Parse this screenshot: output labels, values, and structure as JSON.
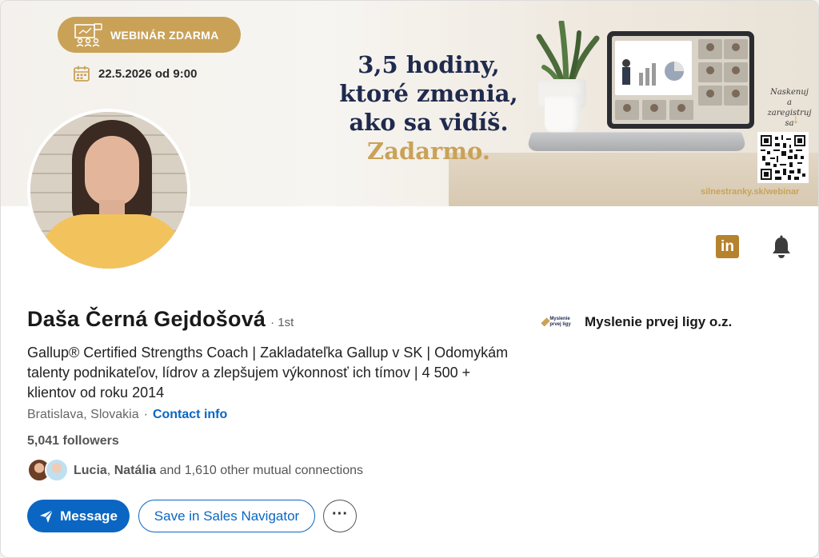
{
  "banner": {
    "pill_label": "WEBINÁR ZDARMA",
    "date": "22.5.2026 od 9:00",
    "headline_lines": [
      "3,5 hodiny,",
      "ktoré zmenia,",
      "ako sa vidíš."
    ],
    "headline_gold": "Zadarmo.",
    "scan_note_1": "Naskenuj",
    "scan_note_2": "a zaregistruj sa",
    "site_url": "silnestranky.sk/webinar",
    "accent_color": "#c9a258",
    "navy_color": "#1f2a4d"
  },
  "profile": {
    "name": "Daša Černá Gejdošová",
    "degree": "· 1st",
    "headline": "Gallup® Certified Strengths Coach | Zakladateľka Gallup v SK | Odomykám talenty podnikateľov, lídrov a zlepšujem výkonnosť ich tímov | 4 500 + klientov od roku 2014",
    "location": "Bratislava, Slovakia",
    "dot": "·",
    "contact_info": "Contact info",
    "followers": "5,041 followers",
    "mutual": {
      "name1": "Lucia",
      "sep": ", ",
      "name2": "Natália",
      "rest": " and 1,610 other mutual connections"
    }
  },
  "icons": {
    "linkedin": "linkedin-icon",
    "linkedin_label": "in",
    "bell": "bell-icon",
    "more_label": "···"
  },
  "actions": {
    "message": "Message",
    "save_sales_navigator": "Save in Sales Navigator"
  },
  "organization": {
    "logo_text": "Myslenie prvej ligy",
    "name": "Myslenie prvej ligy o.z."
  },
  "colors": {
    "primary_blue": "#0a66c2",
    "linkedin_gold": "#b5822f"
  }
}
